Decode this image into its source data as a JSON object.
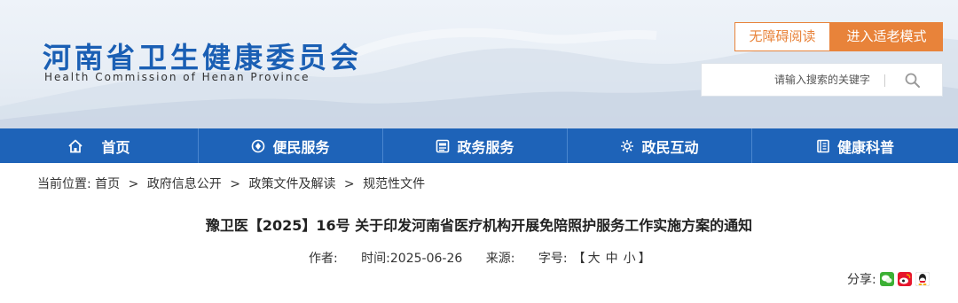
{
  "header": {
    "logo_cn": "河南省卫生健康委员会",
    "logo_en": "Health Commission of Henan Province",
    "accessible_label": "无障碍阅读",
    "elder_mode_label": "进入适老模式",
    "search_placeholder": "请输入搜索的关键字",
    "accent_color": "#e8833a",
    "brand_color": "#1a5fb4"
  },
  "nav": {
    "items": [
      {
        "label": "首页",
        "icon": "home-icon"
      },
      {
        "label": "便民服务",
        "icon": "service-icon"
      },
      {
        "label": "政务服务",
        "icon": "affairs-icon"
      },
      {
        "label": "政民互动",
        "icon": "interaction-icon"
      },
      {
        "label": "健康科普",
        "icon": "book-icon"
      }
    ],
    "bg_color": "#1e63b8"
  },
  "breadcrumb": {
    "prefix": "当前位置:",
    "items": [
      "首页",
      "政府信息公开",
      "政策文件及解读",
      "规范性文件"
    ],
    "separator": ">"
  },
  "article": {
    "title": "豫卫医【2025】16号 关于印发河南省医疗机构开展免陪照护服务工作实施方案的通知",
    "author_label": "作者:",
    "time_label": "时间:",
    "time_value": "2025-06-26",
    "source_label": "来源:",
    "fontsize_label": "字号:",
    "fontsize_open": "【",
    "fontsize_large": "大",
    "fontsize_medium": "中",
    "fontsize_small": "小",
    "fontsize_close": "】"
  },
  "share": {
    "label": "分享:",
    "icons": [
      "wechat-icon",
      "weibo-icon",
      "qq-icon"
    ]
  }
}
